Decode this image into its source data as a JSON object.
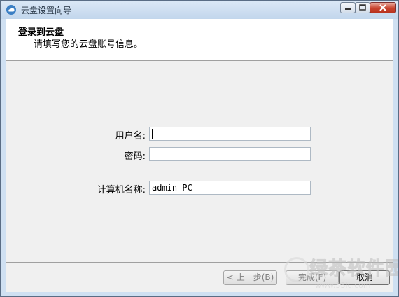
{
  "window": {
    "title": "云盘设置向导"
  },
  "header": {
    "title": "登录到云盘",
    "subtitle": "请填写您的云盘账号信息。"
  },
  "form": {
    "username": {
      "label": "用户名:",
      "value": ""
    },
    "password": {
      "label": "密码:",
      "value": ""
    },
    "computer_name": {
      "label": "计算机名称:",
      "value": "admin-PC"
    }
  },
  "buttons": {
    "back": {
      "chevron": "<",
      "label": "上一步(B)",
      "enabled": false
    },
    "finish": {
      "label": "完成(F)",
      "enabled": false
    },
    "cancel": {
      "label": "取消",
      "enabled": true
    }
  },
  "watermark": {
    "text": "绿茶软件园",
    "url": "www.33lc.com"
  },
  "icons": {
    "app": "cloud-app-icon",
    "minimize": "minimize-icon",
    "maximize": "maximize-icon",
    "close": "close-icon"
  },
  "colors": {
    "titlebar": "#c9dbef",
    "client_bg": "#f0f0f0",
    "header_bg": "#ffffff",
    "close_button": "#c8432e"
  }
}
